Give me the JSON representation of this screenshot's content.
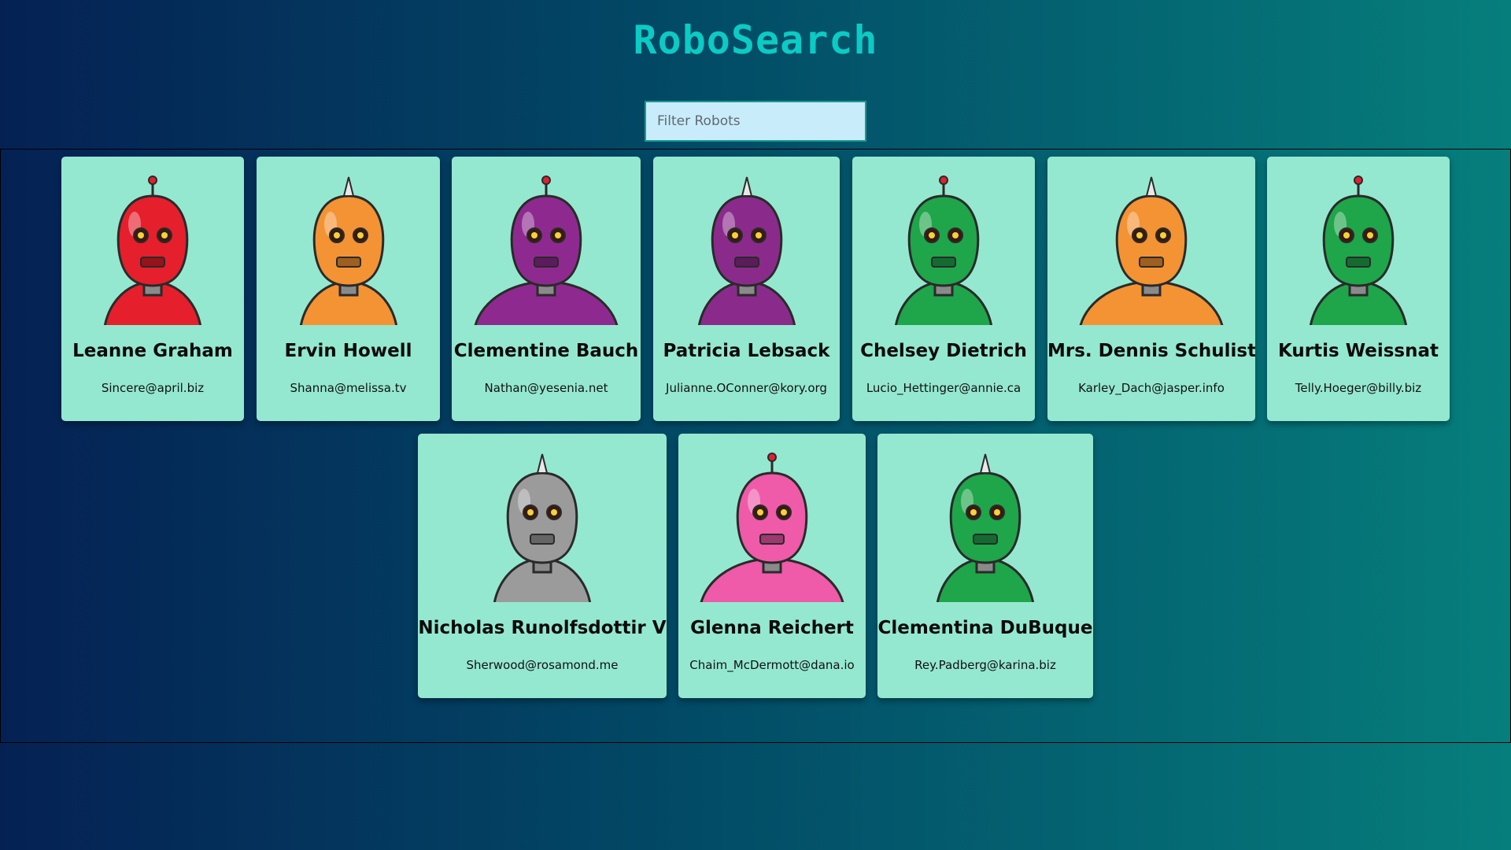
{
  "app": {
    "title": "RoboSearch"
  },
  "search": {
    "placeholder": "Filter Robots",
    "value": ""
  },
  "colors": {
    "title": "#0ccac4",
    "card_background": "#95e8d0",
    "search_background": "#c9ecfb",
    "gradient_start": "#052154",
    "gradient_end": "#067e7c"
  },
  "robots": [
    {
      "name": "Leanne Graham",
      "email": "Sincere@april.biz",
      "color": "#e51f2c",
      "icon": "red-robot-avatar"
    },
    {
      "name": "Ervin Howell",
      "email": "Shanna@melissa.tv",
      "color": "#f39334",
      "icon": "orange-robot-avatar"
    },
    {
      "name": "Clementine Bauch",
      "email": "Nathan@yesenia.net",
      "color": "#8e2a8f",
      "icon": "purple-robot-avatar"
    },
    {
      "name": "Patricia Lebsack",
      "email": "Julianne.OConner@kory.org",
      "color": "#8a2b8c",
      "icon": "purple-robot-avatar"
    },
    {
      "name": "Chelsey Dietrich",
      "email": "Lucio_Hettinger@annie.ca",
      "color": "#1fa54a",
      "icon": "green-robot-avatar"
    },
    {
      "name": "Mrs. Dennis Schulist",
      "email": "Karley_Dach@jasper.info",
      "color": "#f39334",
      "icon": "orange-robot-avatar"
    },
    {
      "name": "Kurtis Weissnat",
      "email": "Telly.Hoeger@billy.biz",
      "color": "#1fa54a",
      "icon": "green-robot-avatar"
    },
    {
      "name": "Nicholas Runolfsdottir V",
      "email": "Sherwood@rosamond.me",
      "color": "#9b9b9b",
      "icon": "gray-robot-avatar"
    },
    {
      "name": "Glenna Reichert",
      "email": "Chaim_McDermott@dana.io",
      "color": "#ef5aa9",
      "icon": "pink-robot-avatar"
    },
    {
      "name": "Clementina DuBuque",
      "email": "Rey.Padberg@karina.biz",
      "color": "#1fa54a",
      "icon": "green-robot-avatar"
    }
  ]
}
